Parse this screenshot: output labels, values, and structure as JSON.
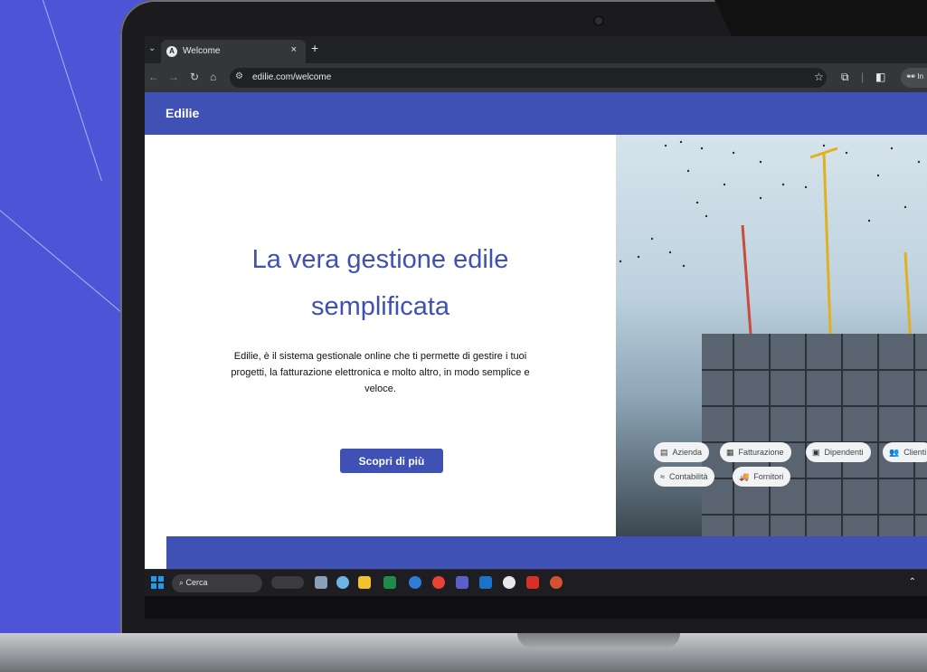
{
  "browser": {
    "tab_menu_icon": "chevron-down-icon",
    "tab_title": "Welcome",
    "tab_close": "×",
    "new_tab": "+",
    "url": "edilie.com/welcome",
    "incognito_label": "In",
    "nav_icons": [
      "back-icon",
      "forward-icon",
      "reload-icon",
      "home-icon"
    ],
    "toolbar_icons": [
      "star-icon",
      "extensions-icon",
      "sidepanel-icon",
      "incognito-icon"
    ]
  },
  "appbar": {
    "brand": "Edilie",
    "color": "#3f51b5"
  },
  "hero": {
    "title_line1": "La vera gestione edile",
    "title_line2": "semplificata",
    "description": "Edilie, è il sistema gestionale online che ti permette di gestire i tuoi progetti, la fatturazione elettronica e molto altro, in modo semplice e veloce.",
    "cta_label": "Scopri di più"
  },
  "features": [
    {
      "label": "Azienda",
      "icon": "building-icon"
    },
    {
      "label": "Fatturazione",
      "icon": "invoice-icon"
    },
    {
      "label": "Dipendenti",
      "icon": "badge-icon"
    },
    {
      "label": "Clienti",
      "icon": "people-icon"
    },
    {
      "label": "Contabilità",
      "icon": "accounting-icon"
    },
    {
      "label": "Fornitori",
      "icon": "truck-icon"
    }
  ],
  "taskbar": {
    "search_placeholder": "Cerca",
    "apps": [
      "cisco-icon",
      "taskview-icon",
      "weather-icon",
      "explorer-icon",
      "excel-icon",
      "webex-icon",
      "chrome-icon",
      "teams-icon",
      "outlook-icon",
      "obs-icon",
      "acrobat-icon",
      "powerpoint-icon"
    ]
  }
}
